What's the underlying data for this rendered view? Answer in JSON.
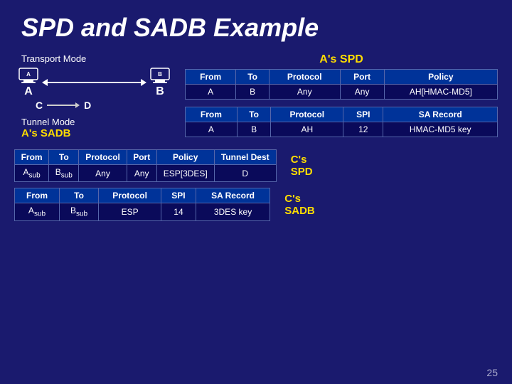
{
  "title": "SPD and SADB Example",
  "left": {
    "transport_mode_label": "Transport Mode",
    "tunnel_mode_label": "Tunnel Mode",
    "as_sadb_label": "A's SADB",
    "node_a": "A",
    "node_b": "B",
    "node_c": "C",
    "node_d": "D"
  },
  "aspd": {
    "label": "A's SPD",
    "spd_table": {
      "headers": [
        "From",
        "To",
        "Protocol",
        "Port",
        "Policy"
      ],
      "rows": [
        [
          "A",
          "B",
          "Any",
          "Any",
          "AH[HMAC-MD5]"
        ]
      ]
    },
    "sadb_table": {
      "headers": [
        "From",
        "To",
        "Protocol",
        "SPI",
        "SA Record"
      ],
      "rows": [
        [
          "A",
          "B",
          "AH",
          "12",
          "HMAC-MD5 key"
        ]
      ]
    }
  },
  "bottom": {
    "cspd": {
      "label": "C's SPD",
      "headers": [
        "From",
        "To",
        "Protocol",
        "Port",
        "Policy",
        "Tunnel Dest"
      ],
      "rows": [
        [
          "Aₛᵤᵇ",
          "Bₛᵤᵇ",
          "Any",
          "Any",
          "ESP[3DES]",
          "D"
        ]
      ]
    },
    "csadb": {
      "label": "C's SADB",
      "headers": [
        "From",
        "To",
        "Protocol",
        "SPI",
        "SA Record"
      ],
      "rows": [
        [
          "Aₛᵤᵇ",
          "Bₛᵤᵇ",
          "ESP",
          "14",
          "3DES key"
        ]
      ]
    }
  },
  "page_number": "25"
}
